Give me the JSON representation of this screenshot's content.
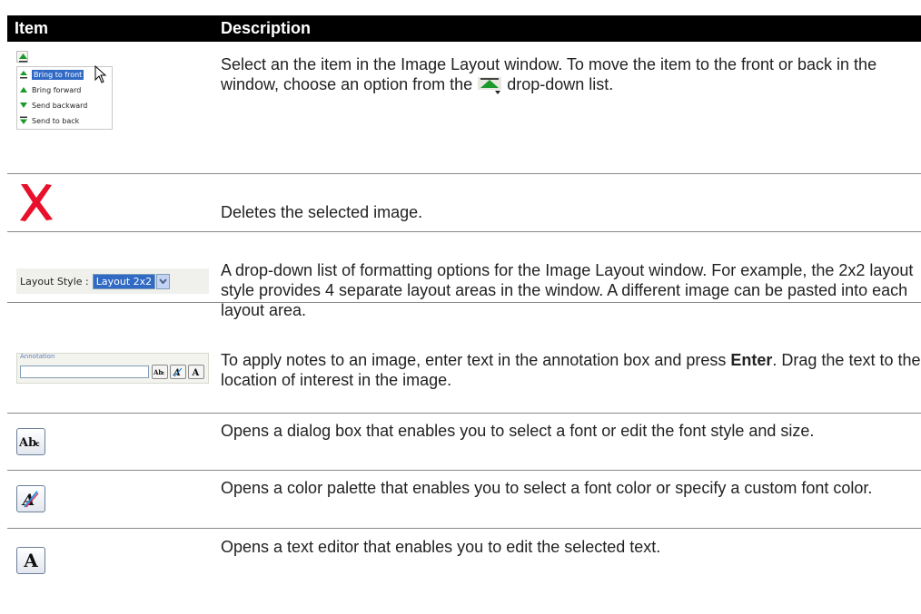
{
  "header": {
    "item": "Item",
    "description": "Description"
  },
  "rows": [
    {
      "menu": [
        "Bring to front",
        "Bring forward",
        "Send backward",
        "Send to back"
      ],
      "desc_part1": "Select an the item in the Image Layout window. To move the item to the front or back in the window, choose an option from the",
      "desc_part2": "drop-down list."
    },
    {
      "desc": "Deletes the selected image."
    },
    {
      "layout_label": "Layout Style :",
      "layout_value": "Layout 2x2",
      "desc": "A drop-down list of formatting options for the Image Layout window. For example, the 2x2 layout style provides 4 separate layout areas in the window. A different image can be pasted into each layout area."
    },
    {
      "annotation_legend": "Annotation",
      "desc_part1": "To apply notes to an image, enter text in the annotation box and press",
      "desc_bold": "Enter",
      "desc_part2": ". Drag the text to the location of interest in the image."
    },
    {
      "button_label": "Abc",
      "desc": "Opens a dialog box that enables you to select a font or edit the font style and size."
    },
    {
      "desc": "Opens a color palette that enables you to select a font color or specify a custom font color."
    },
    {
      "button_label": "A",
      "desc": "Opens a text editor that enables you to edit the selected text."
    }
  ],
  "colors": {
    "header_bg": "#000000",
    "selection": "#316ac5",
    "delete_red": "#e8102a",
    "arrow_green": "#1a9a2a"
  }
}
